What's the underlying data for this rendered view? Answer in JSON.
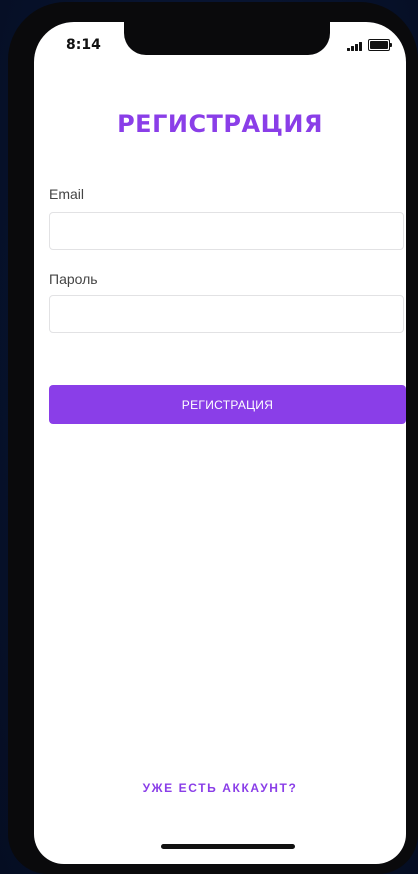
{
  "status_bar": {
    "time": "8:14",
    "signal_icon": "cellular-signal-icon",
    "battery_icon": "battery-icon"
  },
  "page": {
    "title": "РЕГИСТРАЦИЯ"
  },
  "form": {
    "email_label": "Email",
    "email_value": "",
    "password_label": "Пароль",
    "password_value": "",
    "submit_label": "РЕГИСТРАЦИЯ"
  },
  "footer": {
    "login_link": "УЖЕ ЕСТЬ АККАУНТ?"
  },
  "colors": {
    "accent": "#8a3ee8",
    "background": "#071433",
    "screen": "#ffffff"
  }
}
